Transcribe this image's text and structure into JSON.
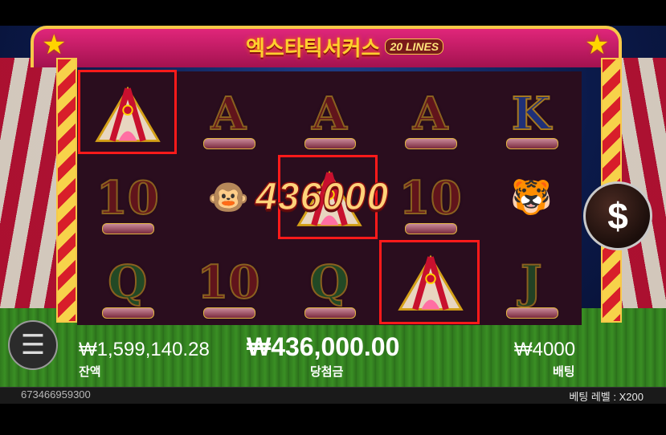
{
  "game": {
    "title": "엑스타틱서커스",
    "lines_badge": "20 LINES"
  },
  "reels": [
    [
      {
        "symbol": "circus-tent"
      },
      {
        "symbol": "A"
      },
      {
        "symbol": "A"
      },
      {
        "symbol": "A"
      },
      {
        "symbol": "K"
      }
    ],
    [
      {
        "symbol": "10"
      },
      {
        "symbol": "monkey"
      },
      {
        "symbol": "circus-tent"
      },
      {
        "symbol": "10"
      },
      {
        "symbol": "tiger"
      }
    ],
    [
      {
        "symbol": "Q"
      },
      {
        "symbol": "10"
      },
      {
        "symbol": "Q"
      },
      {
        "symbol": "circus-tent"
      },
      {
        "symbol": "J"
      }
    ]
  ],
  "win_overlay": "436000",
  "balance": {
    "value": "₩1,599,140.28",
    "label": "잔액"
  },
  "win": {
    "value": "₩436,000.00",
    "label": "당첨금"
  },
  "bet": {
    "value": "₩4000",
    "label": "배팅"
  },
  "footer": {
    "session_id": "673466959300",
    "bet_level_label": "베팅 레벨 :",
    "bet_level_value": "X200"
  },
  "colors": {
    "win_frame": "#ff1a1a",
    "gold": "#f7c948",
    "arch": "#e0267a"
  }
}
